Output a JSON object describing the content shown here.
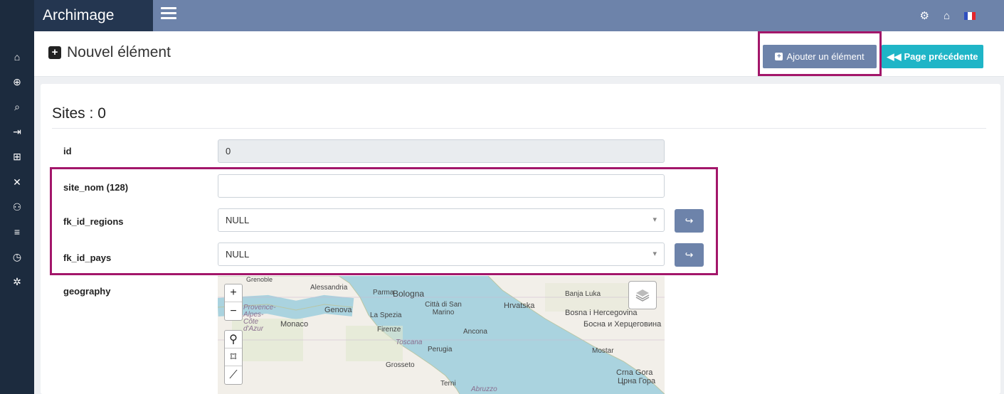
{
  "app": {
    "name": "Archimage"
  },
  "topbar": {
    "icons": [
      "gears-icon",
      "home-icon",
      "flag-fr-icon"
    ]
  },
  "sidebar": {
    "icons": [
      "home-icon",
      "plus-circle-icon",
      "search-icon",
      "sign-in-icon",
      "table-icon",
      "tools-icon",
      "user-edit-icon",
      "database-icon",
      "clock-icon",
      "cogs-icon"
    ]
  },
  "header": {
    "title": "Nouvel élément",
    "add_button": "Ajouter un élément",
    "prev_button": "Page précédente"
  },
  "form": {
    "section_title": "Sites : 0",
    "fields": {
      "id": {
        "label": "id",
        "value": "0"
      },
      "site_nom": {
        "label": "site_nom (128)",
        "value": ""
      },
      "fk_id_regions": {
        "label": "fk_id_regions",
        "value": "NULL"
      },
      "fk_id_pays": {
        "label": "fk_id_pays",
        "value": "NULL"
      },
      "geography": {
        "label": "geography"
      }
    }
  },
  "map": {
    "labels": [
      "Alessandria",
      "Parma",
      "Bologna",
      "Genova",
      "La Spezia",
      "Città di San Marino",
      "Provence-Alpes-Côte d'Azur",
      "Monaco",
      "Firenze",
      "Toscana",
      "Ancona",
      "Perugia",
      "Grosseto",
      "Terni",
      "Abruzzo",
      "Hrvatska",
      "Banja Luka",
      "Bosna i Hercegovina",
      "Босна и Херцеговина",
      "Mostar",
      "Crna Gora",
      "Црна Гора",
      "Grenoble"
    ],
    "colors": {
      "sea": "#aad3df",
      "land": "#f2efe9"
    }
  },
  "colors": {
    "topbar": "#6d83aa",
    "sidebar": "#1c2b3e",
    "accent": "#1fb5c7",
    "highlight": "#a3166a"
  }
}
